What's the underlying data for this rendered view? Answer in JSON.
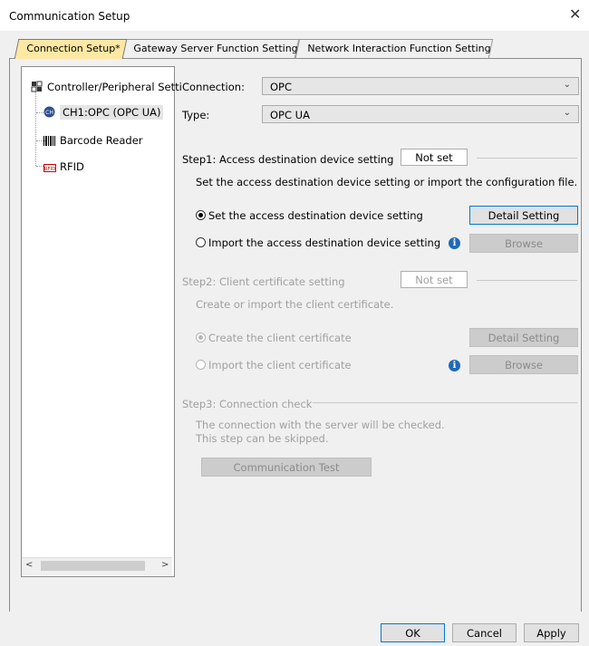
{
  "window": {
    "title": "Communication Setup",
    "close_glyph": "✕"
  },
  "tabs": [
    {
      "label": "Connection Setup*",
      "active": true
    },
    {
      "label": "Gateway Server Function Setting",
      "active": false
    },
    {
      "label": "Network Interaction Function Setting",
      "active": false
    }
  ],
  "tree": {
    "root": "Controller/Peripheral Setti",
    "items": [
      {
        "label": "CH1:OPC (OPC UA)",
        "icon": "ch1-icon",
        "selected": true
      },
      {
        "label": "Barcode Reader",
        "icon": "barcode-icon"
      },
      {
        "label": "RFID",
        "icon": "rfid-icon"
      }
    ]
  },
  "form": {
    "connection_label": "Connection:",
    "connection_value": "OPC",
    "type_label": "Type:",
    "type_value": "OPC UA"
  },
  "step1": {
    "title": "Step1: Access destination device setting",
    "status": "Not set",
    "description": "Set the access destination device setting or import the configuration file.",
    "option_set": "Set the access destination device setting",
    "option_import": "Import the access destination device setting",
    "detail_button": "Detail Setting",
    "browse_button": "Browse"
  },
  "step2": {
    "title": "Step2: Client certificate setting",
    "status": "Not set",
    "description": "Create or import the client certificate.",
    "option_create": "Create the client certificate",
    "option_import": "Import the client certificate",
    "detail_button": "Detail Setting",
    "browse_button": "Browse"
  },
  "step3": {
    "title": "Step3: Connection check",
    "description_line1": "The connection with the server will be checked.",
    "description_line2": "This step can be skipped.",
    "test_button": "Communication Test"
  },
  "footer": {
    "ok": "OK",
    "cancel": "Cancel",
    "apply": "Apply"
  },
  "colors": {
    "active_tab": "#ffe8a3",
    "primary_border": "#0078d7",
    "info_icon": "#1e6ab8"
  }
}
